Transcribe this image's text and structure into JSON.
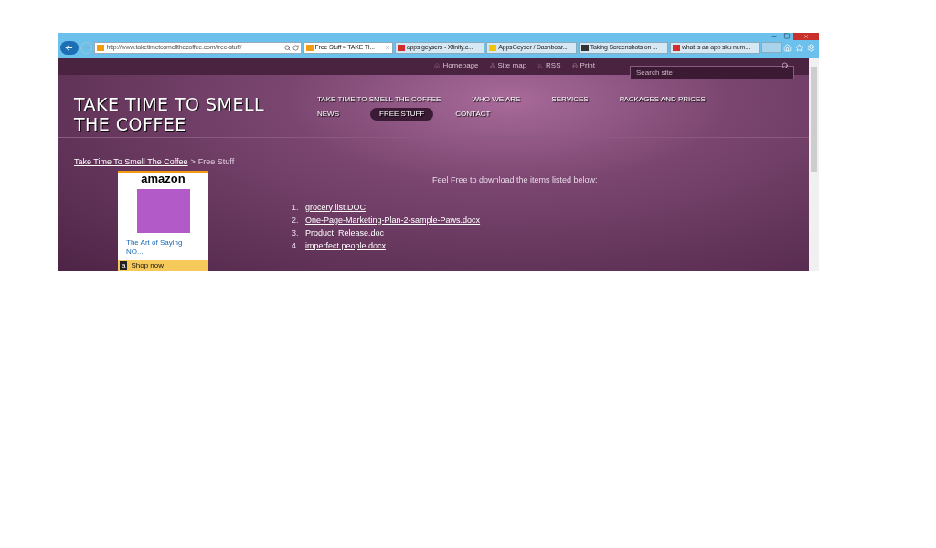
{
  "address_bar": {
    "url": "http://www.taketimetosmellthecoffee.com/free-stuff/"
  },
  "tabs": [
    {
      "label": "Free Stuff ≈ TAKE TI...",
      "selected": true,
      "kind": "orange"
    },
    {
      "label": "apps geysers - Xfinity.c...",
      "selected": false,
      "kind": "red"
    },
    {
      "label": "AppsGeyser / Dashboar...",
      "selected": false,
      "kind": "yellow"
    },
    {
      "label": "Taking Screenshots on ...",
      "selected": false,
      "kind": "dark"
    },
    {
      "label": "what is an app sku num...",
      "selected": false,
      "kind": "red"
    }
  ],
  "site": {
    "utility_links": [
      {
        "label": "Homepage",
        "kind": "home"
      },
      {
        "label": "Site map",
        "kind": "map"
      },
      {
        "label": "RSS",
        "kind": "rss"
      },
      {
        "label": "Print",
        "kind": "print"
      }
    ],
    "search": {
      "placeholder": "Search site"
    },
    "title": "TAKE TIME TO SMELL THE COFFEE",
    "nav": [
      {
        "label": "TAKE TIME TO SMELL THE COFFEE",
        "selected": false
      },
      {
        "label": "WHO WE ARE",
        "selected": false
      },
      {
        "label": "SERVICES",
        "selected": false
      },
      {
        "label": "PACKAGES AND PRICES",
        "selected": false
      },
      {
        "label": "NEWS",
        "selected": false
      },
      {
        "label": "FREE STUFF",
        "selected": true
      },
      {
        "label": "CONTACT",
        "selected": false
      }
    ],
    "breadcrumb": {
      "home": "Take Time To Smell The Coffee",
      "separator": ">",
      "current": "Free Stuff"
    },
    "ad": {
      "brand": "amazon",
      "caption": "The Art of Saying NO...",
      "button": "Shop now",
      "button_icon": "a"
    },
    "intro": "Feel Free to download the items listed below:",
    "files": [
      {
        "number": "1.",
        "label": "grocery list.DOC"
      },
      {
        "number": "2.",
        "label": "One-Page-Marketing-Plan-2-sample-Paws.docx"
      },
      {
        "number": "3.",
        "label": "Product_Release.doc"
      },
      {
        "number": "4.",
        "label": "imperfect people.docx"
      }
    ]
  }
}
